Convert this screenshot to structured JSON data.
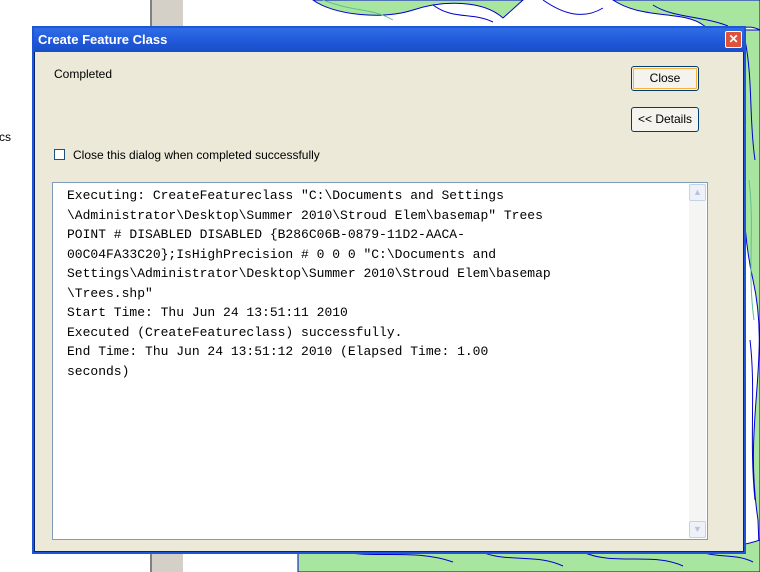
{
  "background": {
    "side_text": "cs"
  },
  "dialog": {
    "title": "Create Feature Class",
    "status": "Completed",
    "close_button": "Close",
    "details_button": "<< Details",
    "close_when_done_label": "Close this dialog when completed successfully",
    "close_when_done_checked": false,
    "log_lines": [
      "Executing: CreateFeatureclass \"C:\\Documents and Settings",
      "\\Administrator\\Desktop\\Summer 2010\\Stroud Elem\\basemap\" Trees",
      "POINT # DISABLED DISABLED {B286C06B-0879-11D2-AACA-",
      "00C04FA33C20};IsHighPrecision # 0 0 0 \"C:\\Documents and",
      "Settings\\Administrator\\Desktop\\Summer 2010\\Stroud Elem\\basemap",
      "\\Trees.shp\"",
      "Start Time: Thu Jun 24 13:51:11 2010",
      "Executed (CreateFeatureclass) successfully.",
      "End Time: Thu Jun 24 13:51:12 2010 (Elapsed Time: 1.00",
      "seconds)"
    ]
  },
  "colors": {
    "titlebar": "#1f57d8",
    "dialog_bg": "#ece9d8",
    "map_lines_blue": "#0000cc",
    "map_lines_green": "#5fbf8f",
    "map_fill": "#a8e6a0"
  },
  "icons": {
    "title_close": "close-icon",
    "scroll_up": "arrow-up-icon",
    "scroll_down": "arrow-down-icon"
  }
}
